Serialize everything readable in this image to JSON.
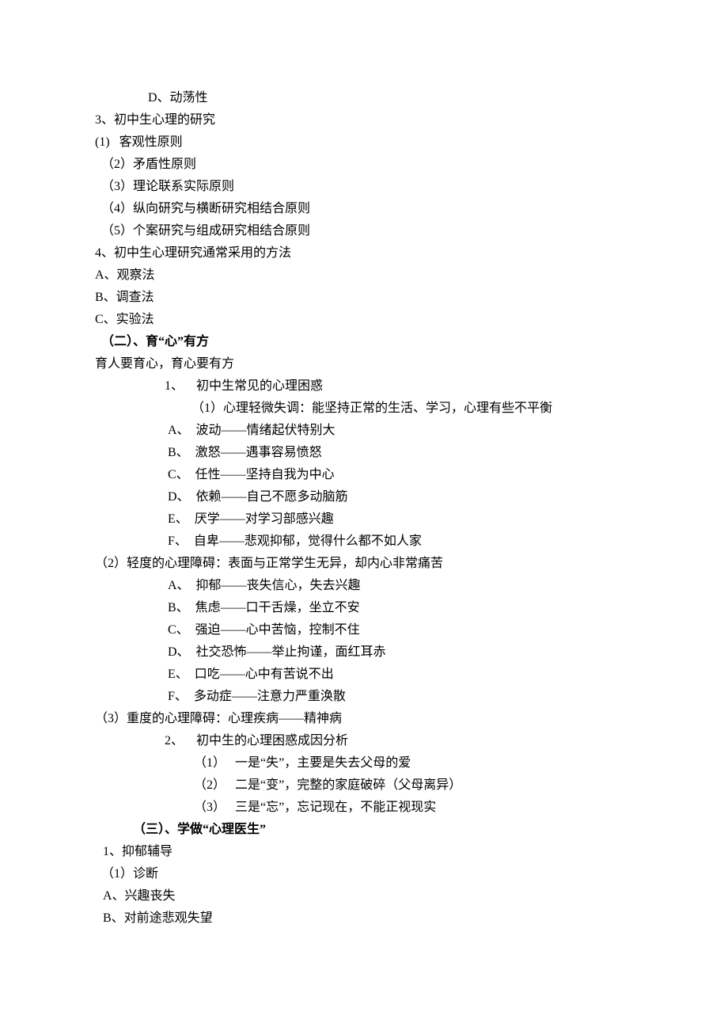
{
  "lines": [
    {
      "cls": "lvl-1b",
      "text": "D、动荡性"
    },
    {
      "cls": "lvl-0",
      "text": "3、初中生心理的研究"
    },
    {
      "cls": "lvl-0",
      "text": "(1)   客观性原则"
    },
    {
      "cls": "lvl-0a",
      "text": "（2）矛盾性原则"
    },
    {
      "cls": "lvl-0a",
      "text": "（3）理论联系实际原则"
    },
    {
      "cls": "lvl-0a",
      "text": "（4）纵向研究与横断研究相结合原则"
    },
    {
      "cls": "lvl-0a",
      "text": "（5）个案研究与组成研究相结合原则"
    },
    {
      "cls": "lvl-0",
      "text": "4、初中生心理研究通常采用的方法"
    },
    {
      "cls": "lvl-0",
      "text": "A、观察法"
    },
    {
      "cls": "lvl-0",
      "text": "B、调查法"
    },
    {
      "cls": "lvl-0",
      "text": "C、实验法"
    },
    {
      "cls": "lvl-0a bold",
      "text": "（二）、育“心”有方"
    },
    {
      "cls": "lvl-0",
      "text": "育人要育心，育心要有方"
    },
    {
      "cls": "lvl-num1",
      "text": "1、　  初中生常见的心理困惑"
    },
    {
      "cls": "lvl-num1a",
      "text": "（1）心理轻微失调：能坚持正常的生活、学习，心理有些不平衡"
    },
    {
      "cls": "lvl-indA",
      "text": "A、  波动——情绪起伏特别大"
    },
    {
      "cls": "lvl-indA",
      "text": "B、  激怒——遇事容易愤怒"
    },
    {
      "cls": "lvl-indA",
      "text": "C、  任性——坚持自我为中心"
    },
    {
      "cls": "lvl-indA",
      "text": "D、  依赖——自己不愿多动脑筋"
    },
    {
      "cls": "lvl-indA",
      "text": "E、  厌学——对学习部感兴趣"
    },
    {
      "cls": "lvl-indA",
      "text": "F、  自卑——悲观抑郁，觉得什么都不如人家"
    },
    {
      "cls": "lvl-0",
      "text": "（2）轻度的心理障碍：表面与正常学生无异，却内心非常痛苦"
    },
    {
      "cls": "lvl-indA",
      "text": "A、  抑郁——丧失信心，失去兴趣"
    },
    {
      "cls": "lvl-indA",
      "text": "B、  焦虑——口干舌燥，坐立不安"
    },
    {
      "cls": "lvl-indA",
      "text": "C、  强迫——心中苦恼，控制不住"
    },
    {
      "cls": "lvl-indA",
      "text": "D、  社交恐怖——举止拘谨，面红耳赤"
    },
    {
      "cls": "lvl-indA",
      "text": "E、  口吃——心中有苦说不出"
    },
    {
      "cls": "lvl-indA",
      "text": "F、  多动症——注意力严重涣散"
    },
    {
      "cls": "lvl-0",
      "text": "（3）重度的心理障碍：心理疾病——精神病"
    },
    {
      "cls": "lvl-num1",
      "text": "2、　  初中生的心理困惑成因分析"
    },
    {
      "cls": "lvl-cause",
      "text": "（1）　 一是“失”，主要是失去父母的爱"
    },
    {
      "cls": "lvl-cause",
      "text": "（2）　 二是“变”，完整的家庭破碎（父母离异）"
    },
    {
      "cls": "lvl-cause",
      "text": "（3）　 三是“忘”，忘记现在，不能正视现实"
    },
    {
      "cls": "lvl-p2 bold",
      "text": "（三）、学做“心理医生”"
    },
    {
      "cls": "lvl-0b",
      "text": "1、抑郁辅导"
    },
    {
      "cls": "lvl-0a",
      "text": "（1）诊断"
    },
    {
      "cls": "lvl-0b",
      "text": "A、兴趣丧失"
    },
    {
      "cls": "lvl-0b",
      "text": "B、对前途悲观失望"
    }
  ]
}
